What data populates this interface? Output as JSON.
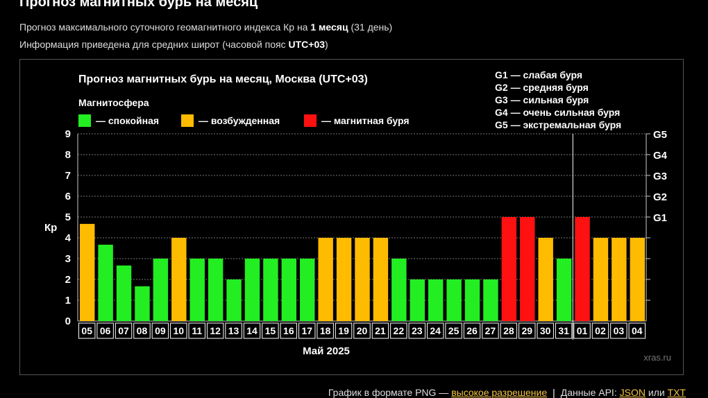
{
  "page": {
    "title": "Прогноз магнитных бурь на месяц",
    "info1": {
      "prefix": "Прогноз максимального суточного геомагнитного индекса Кр на ",
      "bold": "1 месяц",
      "suffix": " (31 день)"
    },
    "info2": {
      "prefix": "Информация приведена для средних широт (часовой пояс ",
      "bold": "UTC+03",
      "suffix": ")"
    }
  },
  "footer": {
    "png_text": "График в формате PNG — ",
    "png_link": "высокое разрешение",
    "separator": "|",
    "api_text": "Данные API: ",
    "json_link": "JSON",
    "or_text": " или ",
    "txt_link": "TXT"
  },
  "chart_data": {
    "type": "bar",
    "title": "Прогноз магнитных бурь на месяц, Москва (UTC+03)",
    "legend_title": "Магнитосфера",
    "legend": [
      {
        "label": "— спокойная",
        "color": "#22ee22"
      },
      {
        "label": "— возбужденная",
        "color": "#ffbb00"
      },
      {
        "label": "— магнитная буря",
        "color": "#ff1111"
      }
    ],
    "storm_levels": [
      "G1 — слабая буря",
      "G2 — средняя буря",
      "G3 — сильная буря",
      "G4 — очень сильная буря",
      "G5 — экстремальная буря"
    ],
    "ylabel": "Кр",
    "xlabel": "Май 2025",
    "ylim": [
      0,
      9
    ],
    "y_ticks": [
      0,
      1,
      2,
      3,
      4,
      5,
      6,
      7,
      8,
      9
    ],
    "right_ticks": [
      {
        "value": 5,
        "label": "G1"
      },
      {
        "value": 6,
        "label": "G2"
      },
      {
        "value": 7,
        "label": "G3"
      },
      {
        "value": 8,
        "label": "G4"
      },
      {
        "value": 9,
        "label": "G5"
      }
    ],
    "grid": true,
    "month_divider_after": "31",
    "categories": [
      "05",
      "06",
      "07",
      "08",
      "09",
      "10",
      "11",
      "12",
      "13",
      "14",
      "15",
      "16",
      "17",
      "18",
      "19",
      "20",
      "21",
      "22",
      "23",
      "24",
      "25",
      "26",
      "27",
      "28",
      "29",
      "30",
      "31",
      "01",
      "02",
      "03",
      "04"
    ],
    "values": [
      4.67,
      3.67,
      2.67,
      1.67,
      3,
      4,
      3,
      3,
      2,
      3,
      3,
      3,
      3,
      4,
      4,
      4,
      4,
      3,
      2,
      2,
      2,
      2,
      2,
      5,
      5,
      4,
      3,
      5,
      4,
      4,
      4
    ],
    "status": [
      "excited",
      "quiet",
      "quiet",
      "quiet",
      "quiet",
      "excited",
      "quiet",
      "quiet",
      "quiet",
      "quiet",
      "quiet",
      "quiet",
      "quiet",
      "excited",
      "excited",
      "excited",
      "excited",
      "quiet",
      "quiet",
      "quiet",
      "quiet",
      "quiet",
      "quiet",
      "storm",
      "storm",
      "excited",
      "quiet",
      "storm",
      "excited",
      "excited",
      "excited"
    ],
    "status_colors": {
      "quiet": "#22ee22",
      "excited": "#ffbb00",
      "storm": "#ff1111"
    },
    "watermark": "xras.ru"
  }
}
